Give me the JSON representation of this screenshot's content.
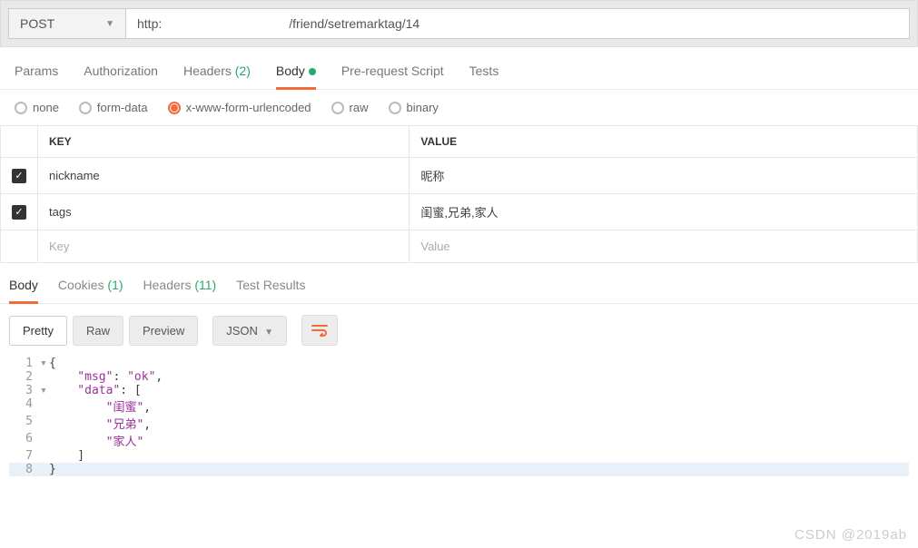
{
  "topbar": {
    "method": "POST",
    "url_prefix": "http:",
    "url_suffix": "/friend/setremarktag/14"
  },
  "tabs": {
    "params": "Params",
    "auth": "Authorization",
    "headers": "Headers",
    "headers_count": "(2)",
    "body": "Body",
    "prerequest": "Pre-request Script",
    "tests": "Tests"
  },
  "body_opts": {
    "none": "none",
    "formdata": "form-data",
    "urlencoded": "x-www-form-urlencoded",
    "raw": "raw",
    "binary": "binary"
  },
  "table": {
    "head_key": "KEY",
    "head_value": "VALUE",
    "rows": [
      {
        "checked": true,
        "key": "nickname",
        "value": "昵称"
      },
      {
        "checked": true,
        "key": "tags",
        "value": "闺蜜,兄弟,家人"
      }
    ],
    "ph_key": "Key",
    "ph_value": "Value"
  },
  "resp_tabs": {
    "body": "Body",
    "cookies": "Cookies",
    "cookies_count": "(1)",
    "headers": "Headers",
    "headers_count": "(11)",
    "tests": "Test Results"
  },
  "toolbar": {
    "pretty": "Pretty",
    "raw": "Raw",
    "preview": "Preview",
    "format": "JSON"
  },
  "editor": {
    "l1": "{",
    "l2a": "    \"msg\"",
    "l2b": ": ",
    "l2c": "\"ok\"",
    "l2d": ",",
    "l3a": "    \"data\"",
    "l3b": ": [",
    "l4a": "        \"闺蜜\"",
    "l4b": ",",
    "l5a": "        \"兄弟\"",
    "l5b": ",",
    "l6": "        \"家人\"",
    "l7": "    ]",
    "l8": "}"
  },
  "watermark": "CSDN @2019ab"
}
